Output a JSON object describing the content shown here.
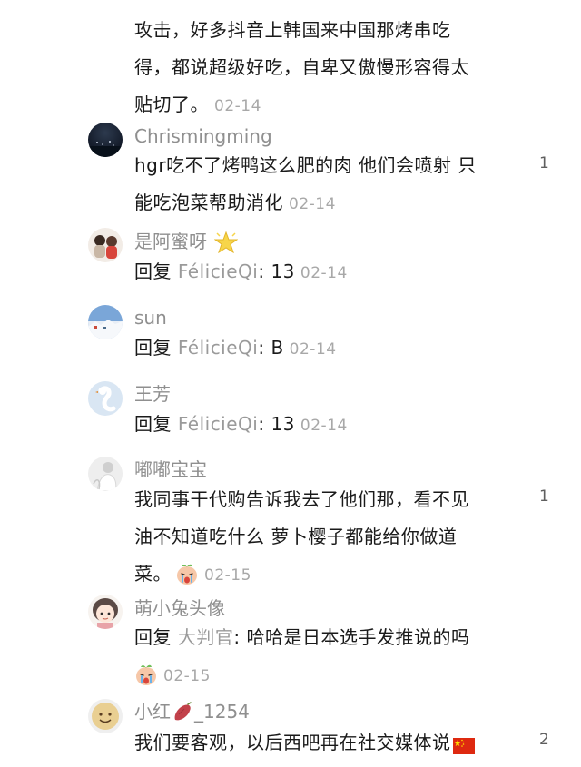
{
  "comments": [
    {
      "text_line1": "攻击，好多抖音上韩国来中国那烤串吃",
      "text_line2": "得，都说超级好吃，自卑又傲慢形容得太",
      "text_line3": "贴切了。",
      "time": "02-14"
    },
    {
      "username": "Chrismingming",
      "text_line1": "hgr吃不了烤鸭这么肥的肉 他们会喷射 只",
      "text_line2": "能吃泡菜帮助消化",
      "time": "02-14",
      "likes": "1"
    },
    {
      "username": "是阿蜜呀",
      "reply_prefix": "回复",
      "reply_to": "FélicieQi",
      "text": ": 13",
      "time": "02-14"
    },
    {
      "username": "sun",
      "reply_prefix": "回复",
      "reply_to": "FélicieQi",
      "text": ": B",
      "time": "02-14"
    },
    {
      "username": "王芳",
      "reply_prefix": "回复",
      "reply_to": "FélicieQi",
      "text": ": 13",
      "time": "02-14"
    },
    {
      "username": "嘟嘟宝宝",
      "text_line1": "我同事干代购告诉我去了他们那，看不见",
      "text_line2": "油不知道吃什么 萝卜樱子都能给你做道",
      "text_line3": "菜。",
      "time": "02-15",
      "likes": "1"
    },
    {
      "username": "萌小兔头像",
      "reply_prefix": "回复",
      "reply_to": "大判官",
      "text": ": 哈哈是日本选手发推说的吗",
      "time": "02-15"
    },
    {
      "username_prefix": "小红",
      "username_suffix": "_1254",
      "text_line1": "我们要客观，以后西吧再在社交媒体说",
      "likes": "2"
    }
  ],
  "colors": {
    "text": "#1a1a1a",
    "username": "#8f8f8f",
    "time": "#a8a8a8"
  }
}
